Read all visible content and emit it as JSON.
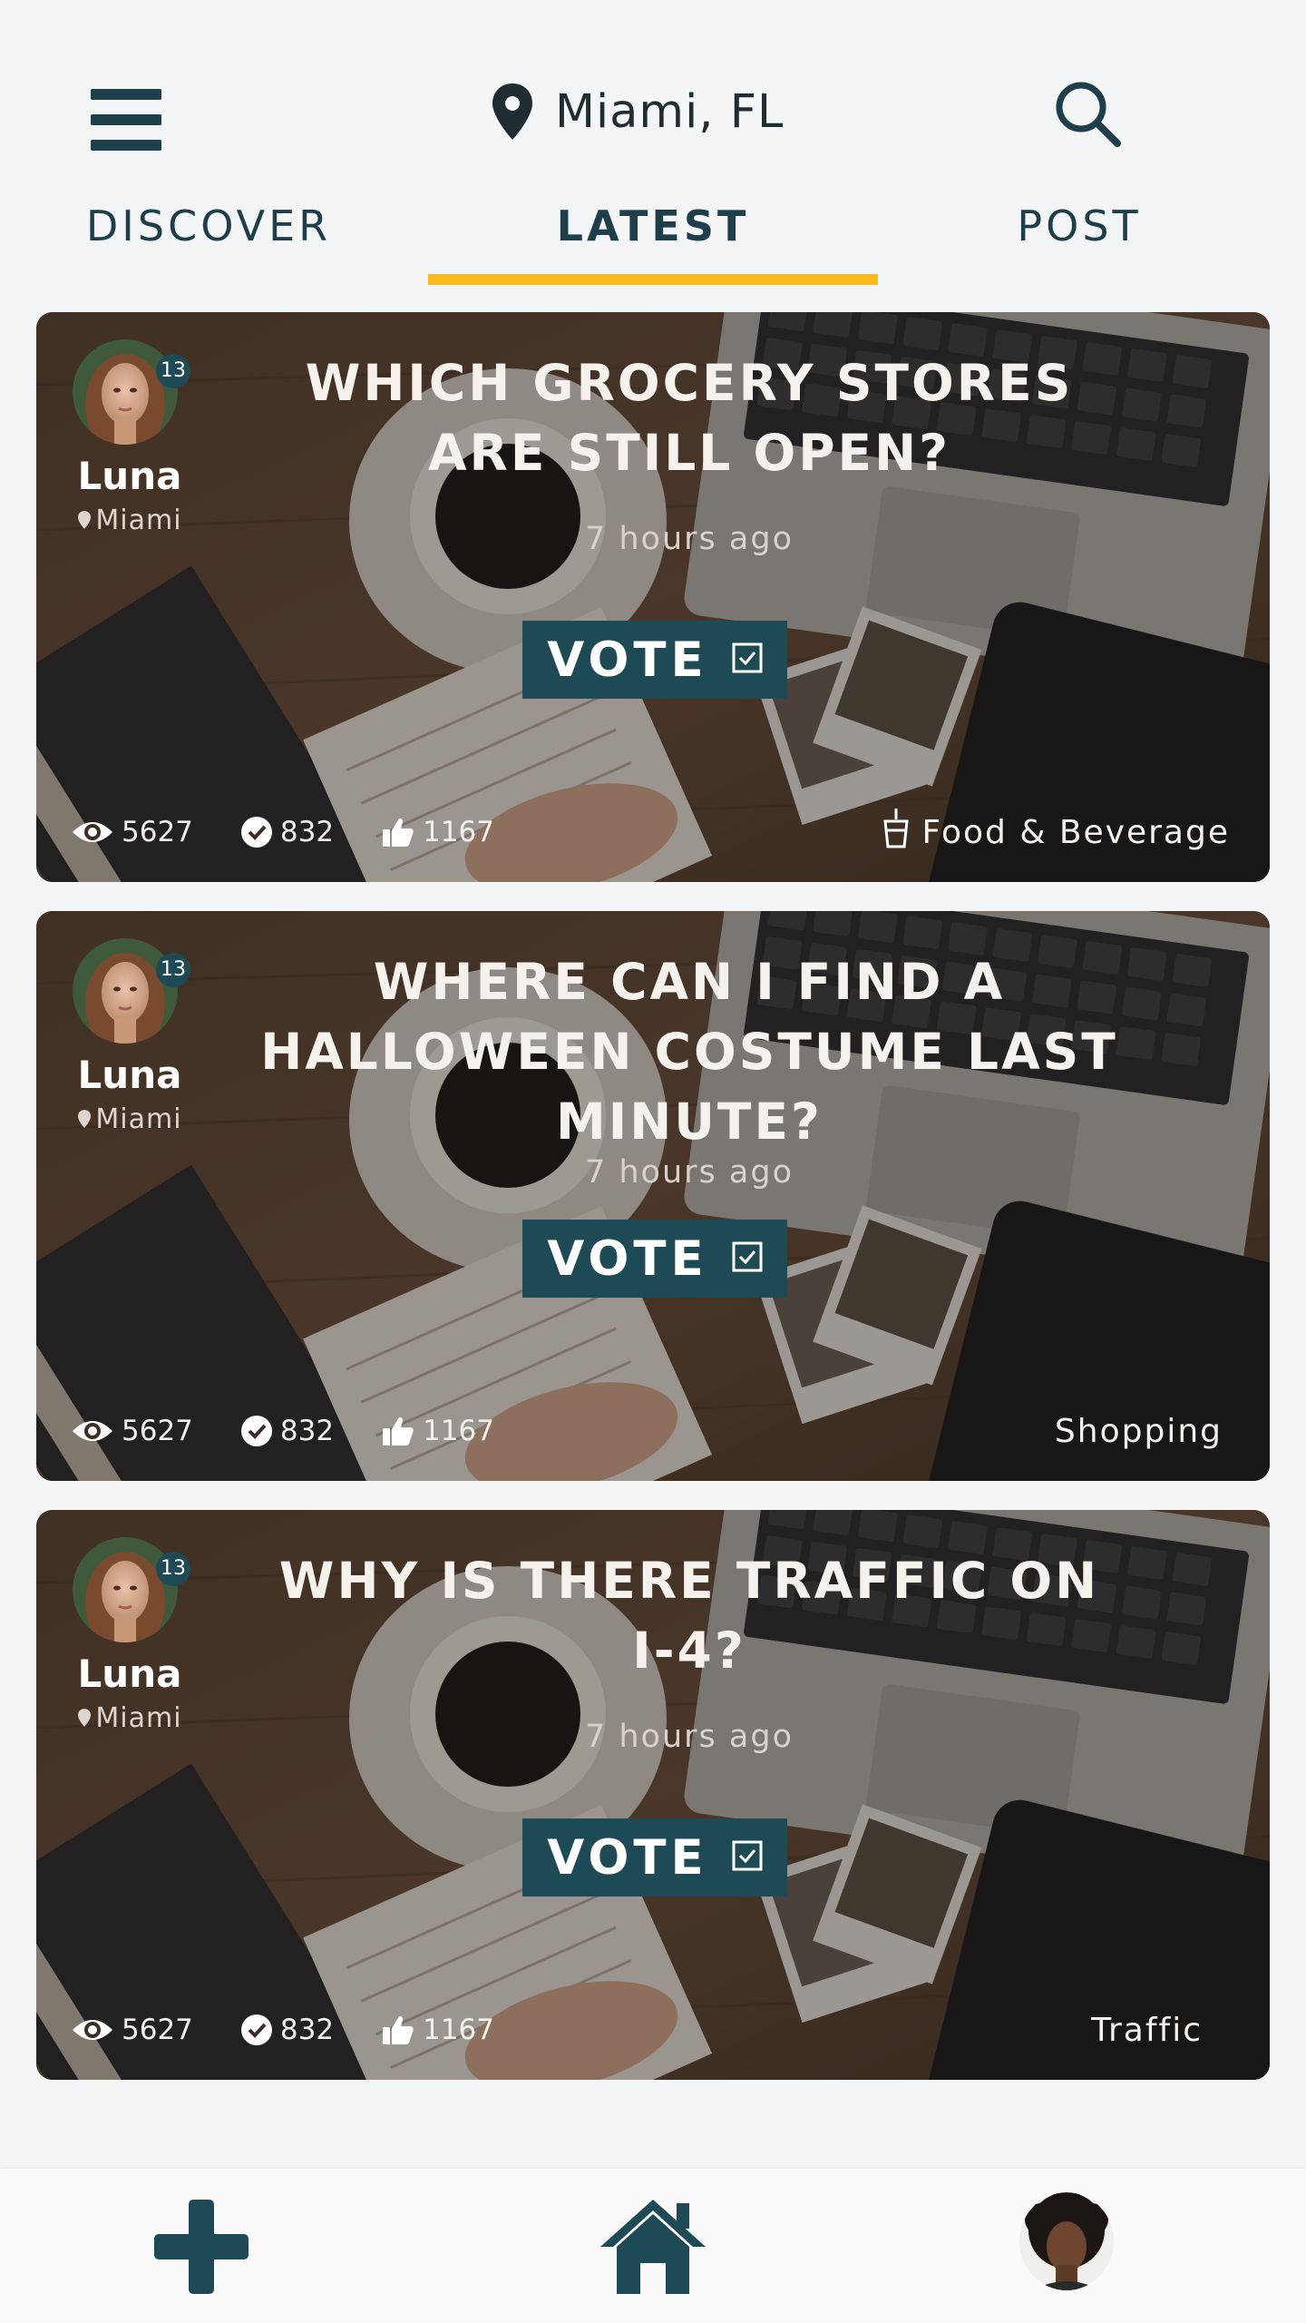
{
  "header": {
    "location": "Miami, FL",
    "tabs": [
      {
        "label": "DISCOVER"
      },
      {
        "label": "LATEST",
        "active": true
      },
      {
        "label": "POST"
      }
    ]
  },
  "posts": [
    {
      "author": {
        "name": "Luna",
        "city": "Miami",
        "level": "13"
      },
      "question": "WHICH GROCERY STORES ARE STILL OPEN?",
      "time": "7 hours ago",
      "vote_label": "VOTE",
      "stats": {
        "views": "5627",
        "votes": "832",
        "likes": "1167"
      },
      "category": "Food & Beverage",
      "category_icon": "drink-cup-icon"
    },
    {
      "author": {
        "name": "Luna",
        "city": "Miami",
        "level": "13"
      },
      "question": "WHERE CAN I FIND A HALLOWEEN COSTUME LAST MINUTE?",
      "time": "7 hours ago",
      "vote_label": "VOTE",
      "stats": {
        "views": "5627",
        "votes": "832",
        "likes": "1167"
      },
      "category": "Shopping"
    },
    {
      "author": {
        "name": "Luna",
        "city": "Miami",
        "level": "13"
      },
      "question": "WHY IS THERE TRAFFIC ON I-4?",
      "time": "7 hours ago",
      "vote_label": "VOTE",
      "stats": {
        "views": "5627",
        "votes": "832",
        "likes": "1167"
      },
      "category": "Traffic"
    }
  ],
  "colors": {
    "accent": "#f9bb1d",
    "primary": "#1e4a56",
    "text_dark": "#1e3e49",
    "background": "#f4f5f6"
  }
}
